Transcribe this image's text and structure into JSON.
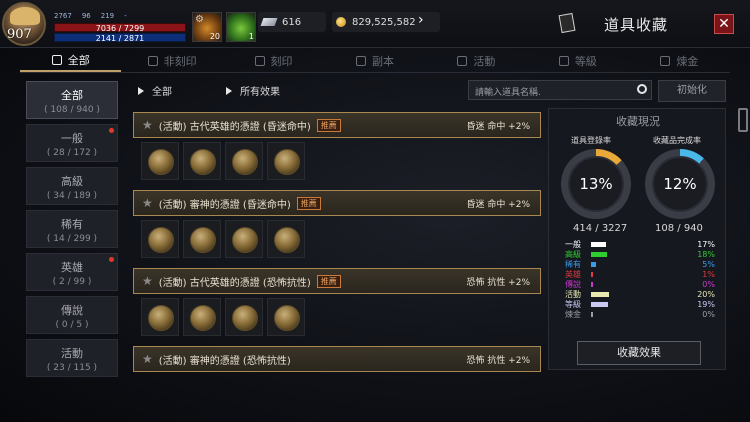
{
  "player": {
    "level": "907",
    "stat1": "2767",
    "stat2": "96",
    "stat3": "219",
    "stat4": "-",
    "hp": "7036 / 7299",
    "mp": "2141 / 2871"
  },
  "slots": [
    {
      "count": "20",
      "icon": "potion-icon"
    },
    {
      "count": "1",
      "icon": "herb-icon"
    }
  ],
  "currency": {
    "diamonds": "616",
    "gold": "829,525,582"
  },
  "header": {
    "title": "道具收藏"
  },
  "tabs": [
    "全部",
    "非刻印",
    "刻印",
    "副本",
    "活動",
    "等級",
    "煉金"
  ],
  "categories": [
    {
      "name": "全部",
      "count": "( 108 / 940 )",
      "dot": false
    },
    {
      "name": "一般",
      "count": "( 28 / 172 )",
      "dot": true
    },
    {
      "name": "高級",
      "count": "( 34 / 189 )",
      "dot": false
    },
    {
      "name": "稀有",
      "count": "( 14 / 299 )",
      "dot": false
    },
    {
      "name": "英雄",
      "count": "( 2 / 99 )",
      "dot": true
    },
    {
      "name": "傳說",
      "count": "( 0 / 5 )",
      "dot": false
    },
    {
      "name": "活動",
      "count": "( 23 / 115 )",
      "dot": false
    }
  ],
  "filter": {
    "category": "全部",
    "effect": "所有效果",
    "search_placeholder": "請輸入道具名稱.",
    "reset": "初始化"
  },
  "groups": [
    {
      "name": "(活動) 古代英雄的憑證 (昏迷命中)",
      "tag": "推薦",
      "effect": "昏迷 命中 +2%"
    },
    {
      "name": "(活動) 審神的憑證 (昏迷命中)",
      "tag": "推薦",
      "effect": "昏迷 命中 +2%"
    },
    {
      "name": "(活動) 古代英雄的憑證 (恐怖抗性)",
      "tag": "推薦",
      "effect": "恐怖 抗性 +2%"
    },
    {
      "name": "(活動) 審神的憑證 (恐怖抗性)",
      "tag": "推薦",
      "effect": "恐怖 抗性 +2%"
    }
  ],
  "panel": {
    "title": "收藏現況",
    "reg_label": "道具登錄率",
    "reg_pct": "13%",
    "reg_val": "414 / 3227",
    "comp_label": "收藏品完成率",
    "comp_pct": "12%",
    "comp_val": "108 / 940",
    "button": "收藏效果",
    "rows": [
      {
        "label": "一般",
        "pct": "17%",
        "color": "#ffffff",
        "w": 0.17
      },
      {
        "label": "高級",
        "pct": "18%",
        "color": "#2ecc2e",
        "w": 0.18
      },
      {
        "label": "稀有",
        "pct": "5%",
        "color": "#3a9be8",
        "w": 0.05
      },
      {
        "label": "英雄",
        "pct": "1%",
        "color": "#e03a3a",
        "w": 0.01
      },
      {
        "label": "傳說",
        "pct": "0%",
        "color": "#c83ac8",
        "w": 0.0
      },
      {
        "label": "活動",
        "pct": "20%",
        "color": "#e8e8b0",
        "w": 0.2
      },
      {
        "label": "等級",
        "pct": "19%",
        "color": "#c8c8f0",
        "w": 0.19
      },
      {
        "label": "煉金",
        "pct": "0%",
        "color": "#9a9da5",
        "w": 0.0
      }
    ]
  }
}
